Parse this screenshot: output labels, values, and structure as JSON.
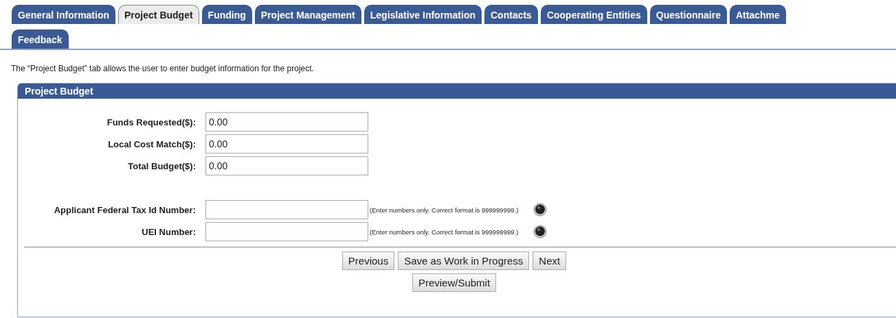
{
  "tab_rows": [
    [
      {
        "label": "General Information",
        "selected": false
      },
      {
        "label": "Project Budget",
        "selected": true
      },
      {
        "label": "Funding",
        "selected": false
      },
      {
        "label": "Project Management",
        "selected": false
      },
      {
        "label": "Legislative Information",
        "selected": false
      },
      {
        "label": "Contacts",
        "selected": false
      },
      {
        "label": "Cooperating Entities",
        "selected": false
      },
      {
        "label": "Questionnaire",
        "selected": false
      },
      {
        "label": "Attachme",
        "selected": false
      }
    ],
    [
      {
        "label": "Feedback",
        "selected": false
      }
    ]
  ],
  "description": "The “Project Budget” tab allows the user to enter budget information for the project.",
  "panel": {
    "title": "Project Budget",
    "budget_fields": [
      {
        "label": "Funds Requested($):",
        "value": "0.00"
      },
      {
        "label": "Local Cost Match($):",
        "value": "0.00"
      },
      {
        "label": "Total Budget($):",
        "value": "0.00"
      }
    ],
    "id_fields": [
      {
        "label": "Applicant Federal Tax Id Number:",
        "hint": "(Enter numbers only. Correct format is 999999999.)"
      },
      {
        "label": "UEI Number:",
        "hint": "(Enter numbers only. Correct format is 999999999.)"
      }
    ],
    "buttons": [
      "Previous",
      "Save as Work in Progress",
      "Next"
    ],
    "submit_button": "Preview/Submit"
  }
}
